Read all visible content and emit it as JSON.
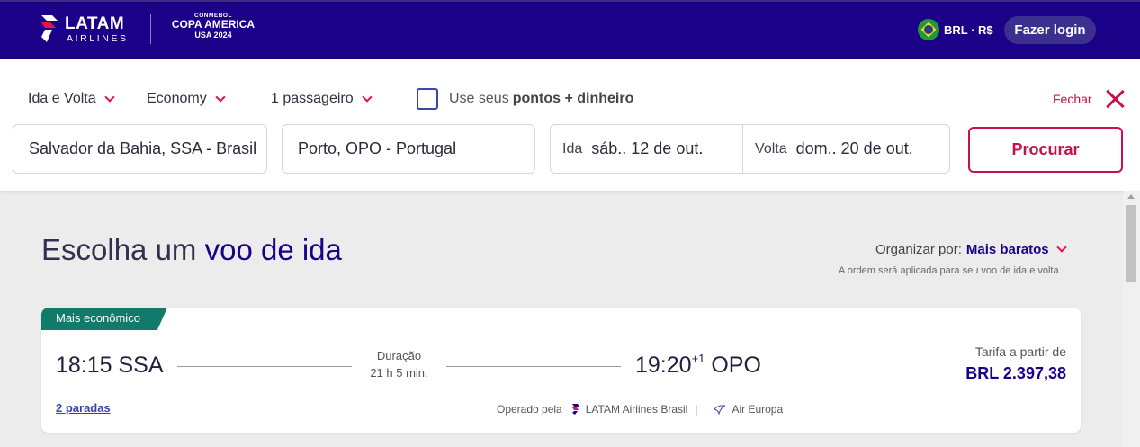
{
  "header": {
    "brand_name": "LATAM",
    "brand_sub": "AIRLINES",
    "event_top": "CONMEBOL",
    "event_name": "COPA AMERICA",
    "event_sub": "USA 2024",
    "currency": "BRL · R$",
    "login_label": "Fazer login"
  },
  "search": {
    "trip_type": "Ida e Volta",
    "cabin": "Economy",
    "passengers": "1 passageiro",
    "points_prefix": "Use seus",
    "points_bold": "pontos + dinheiro",
    "close_label": "Fechar",
    "origin": "Salvador da Bahia, SSA - Brasil",
    "destination": "Porto, OPO - Portugal",
    "depart_label": "Ida",
    "depart_value": "sáb.. 12 de out.",
    "return_label": "Volta",
    "return_value": "dom.. 20 de out.",
    "search_label": "Procurar"
  },
  "results": {
    "heading_prefix": "Escolha um",
    "heading_bold": "voo de ida",
    "sort_label": "Organizar por:",
    "sort_value": "Mais baratos",
    "sort_note": "A ordem será aplicada para seu voo de ida e volta.",
    "flights": [
      {
        "badge": "Mais econômico",
        "depart": "18:15 SSA",
        "duration_label": "Duração",
        "duration_value": "21 h 5 min.",
        "arrive_time": "19:20",
        "arrive_offset": "+1",
        "arrive_code": "OPO",
        "fare_label": "Tarifa a partir de",
        "fare_value": "BRL 2.397,38",
        "stops": "2 paradas",
        "operated_label": "Operado pela",
        "carrier_1": "LATAM Airlines Brasil",
        "carrier_2": "Air Europa"
      }
    ]
  },
  "colors": {
    "brand_navy": "#1b0088",
    "accent_red": "#e8114b",
    "badge_teal": "#117a6b"
  },
  "icons": [
    "latam-logo-icon",
    "brazil-flag-icon",
    "chevron-down-icon",
    "checkbox-icon",
    "close-icon",
    "latam-small-icon",
    "air-europa-icon"
  ]
}
